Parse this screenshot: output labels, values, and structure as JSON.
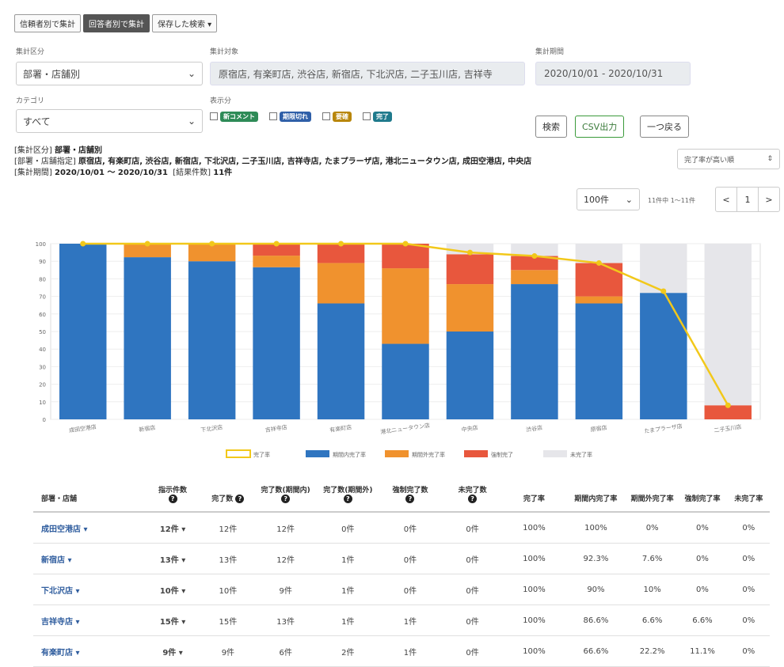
{
  "toolbar": {
    "buttons": [
      "信頼者別で集計",
      "回答者別で集計",
      "保存した検索 ▾"
    ],
    "active_index": 1
  },
  "filters": {
    "group_label": "集計区分",
    "group_value": "部署・店舗別",
    "target_label": "集計対象",
    "target_value": "原宿店, 有楽町店, 渋谷店, 新宿店, 下北沢店, 二子玉川店, 吉祥寺",
    "period_label": "集計期間",
    "period_value": "2020/10/01 - 2020/10/31",
    "category_label": "カテゴリ",
    "category_value": "すべて",
    "status_label": "表示分",
    "status_tags": [
      {
        "label": "新コメント",
        "color": "#2e8b57"
      },
      {
        "label": "期限切れ",
        "color": "#2f5fa8"
      },
      {
        "label": "要確",
        "color": "#b8860b"
      },
      {
        "label": "完了",
        "color": "#1f7a8c"
      }
    ],
    "search_button": "検索",
    "csv_button": "CSV出力",
    "back_button": "一つ戻る"
  },
  "summary": {
    "line1_label": "[集計区分]",
    "line1_value": "部署・店舗別",
    "line2_label": "[部署・店舗指定]",
    "line2_value": "原宿店, 有楽町店, 渋谷店, 新宿店, 下北沢店, 二子玉川店, 吉祥寺店, たまプラーザ店, 港北ニュータウン店, 成田空港店, 中央店",
    "line3_label": "[集計期間]",
    "line3_value": "2020/10/01 〜 2020/10/31",
    "count_label": "[結果件数]",
    "count_value": "11件",
    "sort_select": "完了率が高い順"
  },
  "pager": {
    "per_page": "100件",
    "range_text": "11件中 1〜11件",
    "prev": "<",
    "page": "1",
    "next": ">"
  },
  "chart_data": {
    "type": "bar",
    "stacked": true,
    "categories": [
      "成田空港店",
      "新宿店",
      "下北沢店",
      "吉祥寺店",
      "有楽町店",
      "港北ニュータウン店",
      "中央店",
      "渋谷店",
      "原宿店",
      "たまプラーザ店",
      "二子玉川店"
    ],
    "series": [
      {
        "name": "期間内完了率",
        "color": "#2f75c0",
        "values": [
          100,
          92.3,
          90,
          86.6,
          66,
          43,
          50,
          77,
          66,
          72,
          0
        ]
      },
      {
        "name": "期間外完了率",
        "color": "#f0922e",
        "values": [
          0,
          7.6,
          10,
          6.6,
          23,
          43,
          27,
          8,
          4,
          0,
          0
        ]
      },
      {
        "name": "強制完了",
        "color": "#e8573d",
        "values": [
          0,
          0,
          0,
          6.6,
          11,
          14,
          17,
          8,
          19,
          0,
          8
        ]
      },
      {
        "name": "未完了率",
        "color": "#e6e6ea",
        "values": [
          0,
          0.1,
          0,
          0.2,
          0,
          0,
          6,
          7,
          11,
          28,
          92
        ]
      }
    ],
    "line": {
      "name": "完了率",
      "color": "#f2c81a",
      "values": [
        100,
        100,
        100,
        100,
        100,
        100,
        95,
        93,
        89,
        73,
        8
      ]
    },
    "yticks": [
      "100",
      "90",
      "80",
      "70",
      "60",
      "50",
      "40",
      "30",
      "20",
      "10",
      "0"
    ],
    "ylim": [
      0,
      100
    ],
    "legend": [
      "完了率",
      "期間内完了率",
      "期間外完了率",
      "強制完了",
      "未完了率"
    ],
    "legend_position": "bottom"
  },
  "table": {
    "headers": [
      "部署・店舗",
      "指示件数",
      "完了数",
      "完了数(期間内)",
      "完了数(期間外)",
      "強制完了数",
      "未完了数",
      "完了率",
      "期間内完了率",
      "期間外完了率",
      "強制完了率",
      "未完了率"
    ],
    "rows": [
      [
        "成田空港店 ▾",
        "12件 ▾",
        "12件",
        "12件",
        "0件",
        "0件",
        "0件",
        "100%",
        "100%",
        "0%",
        "0%",
        "0%"
      ],
      [
        "新宿店 ▾",
        "13件 ▾",
        "13件",
        "12件",
        "1件",
        "0件",
        "0件",
        "100%",
        "92.3%",
        "7.6%",
        "0%",
        "0%"
      ],
      [
        "下北沢店 ▾",
        "10件 ▾",
        "10件",
        "9件",
        "1件",
        "0件",
        "0件",
        "100%",
        "90%",
        "10%",
        "0%",
        "0%"
      ],
      [
        "吉祥寺店 ▾",
        "15件 ▾",
        "15件",
        "13件",
        "1件",
        "1件",
        "0件",
        "100%",
        "86.6%",
        "6.6%",
        "6.6%",
        "0%"
      ],
      [
        "有楽町店 ▾",
        "9件 ▾",
        "9件",
        "6件",
        "2件",
        "1件",
        "0件",
        "100%",
        "66.6%",
        "22.2%",
        "11.1%",
        "0%"
      ]
    ]
  }
}
